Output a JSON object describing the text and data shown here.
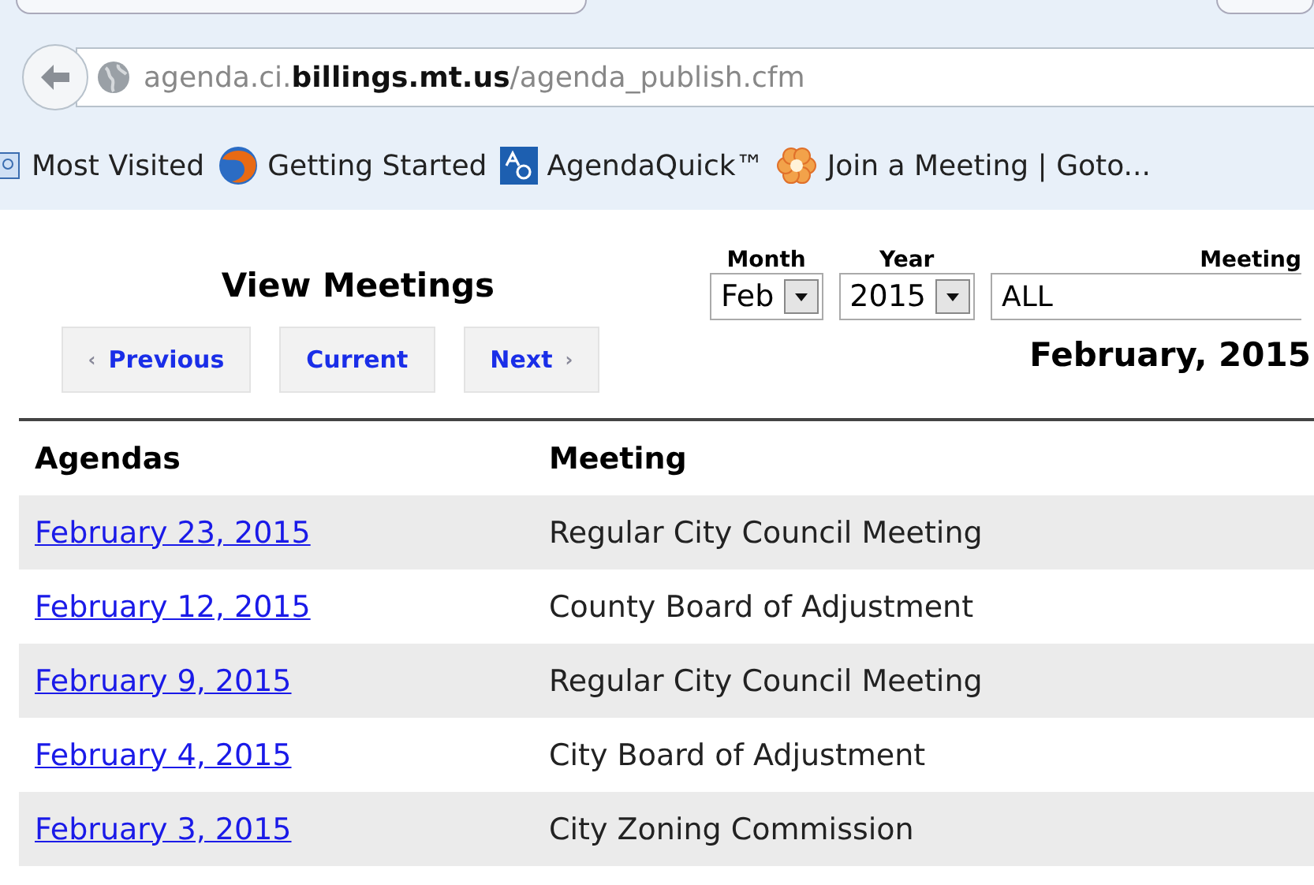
{
  "browser": {
    "url_host_prefix": "agenda.ci.",
    "url_host_domain": "billings.mt.us",
    "url_path": "/agenda_publish.cfm",
    "bookmarks": [
      {
        "label": "Most Visited",
        "kind": "page"
      },
      {
        "label": "Getting Started",
        "kind": "firefox"
      },
      {
        "label": "AgendaQuick™",
        "kind": "aq"
      },
      {
        "label": "Join a Meeting | Goto...",
        "kind": "flower"
      }
    ]
  },
  "page": {
    "title": "View Meetings",
    "nav_buttons": [
      {
        "label": "Previous",
        "arrow_before": "‹"
      },
      {
        "label": "Current"
      },
      {
        "label": "Next",
        "arrow_after": "›"
      }
    ],
    "filters": [
      {
        "label": "Month",
        "value": "Feb",
        "kind": "select"
      },
      {
        "label": "Year",
        "value": "2015",
        "kind": "select"
      },
      {
        "label": "Meeting",
        "value": "ALL",
        "kind": "text"
      }
    ],
    "period": "February, 2015"
  },
  "table": {
    "columns": [
      "Agendas",
      "Meeting"
    ],
    "rows": [
      {
        "date": "February 23, 2015",
        "meeting": "Regular City Council Meeting"
      },
      {
        "date": "February 12, 2015",
        "meeting": "County Board of Adjustment"
      },
      {
        "date": "February 9, 2015",
        "meeting": "Regular City Council Meeting"
      },
      {
        "date": "February 4, 2015",
        "meeting": "City Board of Adjustment"
      },
      {
        "date": "February 3, 2015",
        "meeting": "City Zoning Commission"
      }
    ]
  }
}
